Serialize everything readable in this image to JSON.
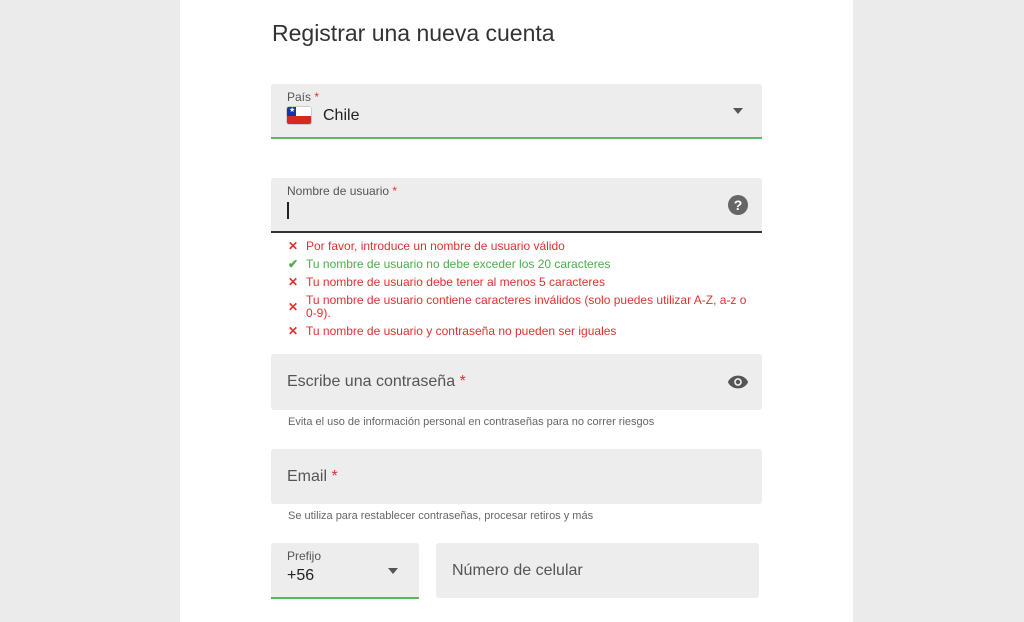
{
  "form": {
    "title": "Registrar una nueva cuenta",
    "country": {
      "label": "País",
      "required_mark": "*",
      "value": "Chile"
    },
    "username": {
      "label": "Nombre de usuario",
      "required_mark": "*",
      "help_icon": "?"
    },
    "rules": [
      {
        "status": "invalid",
        "mark": "✕",
        "text": "Por favor, introduce un nombre de usuario válido"
      },
      {
        "status": "valid",
        "mark": "✔",
        "text": "Tu nombre de usuario no debe exceder los 20 caracteres"
      },
      {
        "status": "invalid",
        "mark": "✕",
        "text": "Tu nombre de usuario debe tener al menos 5 caracteres"
      },
      {
        "status": "invalid",
        "mark": "✕",
        "text": "Tu nombre de usuario contiene caracteres inválidos (solo puedes utilizar A-Z, a-z o 0-9)."
      },
      {
        "status": "invalid",
        "mark": "✕",
        "text": "Tu nombre de usuario y contraseña no pueden ser iguales"
      }
    ],
    "password": {
      "placeholder": "Escribe una contraseña",
      "required_mark": "*",
      "hint": "Evita el uso de información personal en contraseñas para no correr riesgos"
    },
    "email": {
      "placeholder": "Email",
      "required_mark": "*",
      "hint": "Se utiliza para restablecer contraseñas, procesar retiros y más"
    },
    "prefix": {
      "label": "Prefijo",
      "value": "+56"
    },
    "phone": {
      "placeholder": "Número de celular"
    }
  },
  "colors": {
    "error": "#e03131",
    "success": "#4cae4c",
    "field_bg": "#ededed",
    "active_border": "#5cb85c"
  }
}
